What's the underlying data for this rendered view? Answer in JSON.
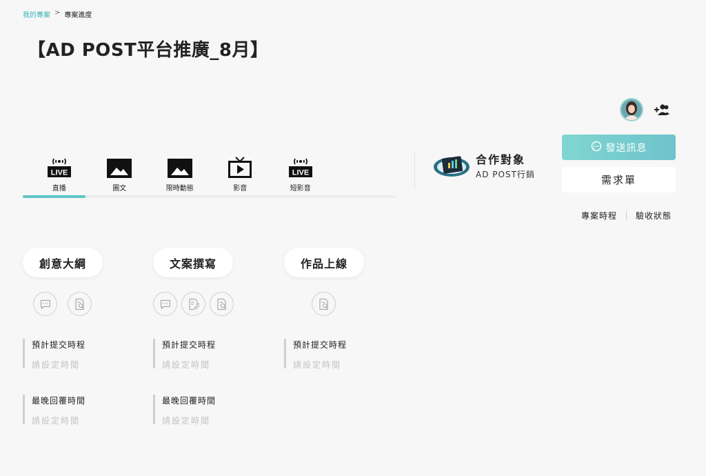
{
  "breadcrumb": {
    "parent": "我的專案",
    "separator": ">",
    "current": "專案進度"
  },
  "page_title": "【AD POST平台推廣_8月】",
  "tabs": [
    {
      "label": "直播",
      "icon": "live-icon",
      "active": true
    },
    {
      "label": "圖文",
      "icon": "image-icon",
      "active": false
    },
    {
      "label": "限時動態",
      "icon": "image-icon",
      "active": false
    },
    {
      "label": "影音",
      "icon": "tv-play-icon",
      "active": false
    },
    {
      "label": "短影音",
      "icon": "live-icon",
      "active": false
    }
  ],
  "live_badge_text": "LIVE",
  "partner": {
    "title": "合作對象",
    "name": "AD POST行銷"
  },
  "actions": {
    "message_label": "發送訊息",
    "request_label": "需求單"
  },
  "links": {
    "schedule": "專案時程",
    "acceptance": "驗收狀態"
  },
  "stages": [
    {
      "title": "創意大綱",
      "icons": [
        "comment-icon",
        "doc-search-icon"
      ],
      "fields": [
        {
          "label": "預計提交時程",
          "value": "請設定時間"
        },
        {
          "label": "最晚回覆時間",
          "value": "請設定時間"
        }
      ]
    },
    {
      "title": "文案撰寫",
      "icons": [
        "comment-icon",
        "doc-edit-icon",
        "doc-search-icon"
      ],
      "fields": [
        {
          "label": "預計提交時程",
          "value": "請設定時間"
        },
        {
          "label": "最晚回覆時間",
          "value": "請設定時間"
        }
      ]
    },
    {
      "title": "作品上線",
      "icons": [
        "doc-search-icon"
      ],
      "fields": [
        {
          "label": "預計提交時程",
          "value": "請設定時間"
        }
      ]
    }
  ],
  "colors": {
    "accent": "#5ec6c6",
    "button_gradient_start": "#7fd6d0",
    "button_gradient_end": "#6ec3cc"
  }
}
